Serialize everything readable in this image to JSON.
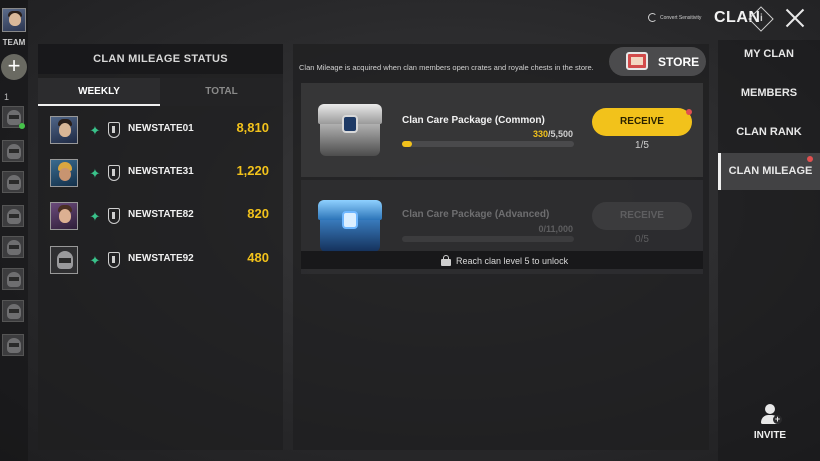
{
  "header": {
    "title": "CLAN",
    "convert_label": "Convert Sensitivity",
    "info_icon": "info-icon",
    "close_icon": "close-icon"
  },
  "team_rail": {
    "label": "TEAM",
    "add_icon": "plus-icon",
    "group_number": "1",
    "slots": 8
  },
  "mileage_panel": {
    "title": "CLAN MILEAGE STATUS",
    "tabs": [
      {
        "label": "WEEKLY",
        "active": true
      },
      {
        "label": "TOTAL",
        "active": false
      }
    ],
    "rows": [
      {
        "name": "NEWSTATE01",
        "score": "8,810"
      },
      {
        "name": "NEWSTATE31",
        "score": "1,220"
      },
      {
        "name": "NEWSTATE82",
        "score": "820"
      },
      {
        "name": "NEWSTATE92",
        "score": "480"
      }
    ]
  },
  "main": {
    "info_text": "Clan Mileage is acquired when clan members open crates and royale chests in the store.",
    "store_label": "STORE",
    "packages": [
      {
        "name": "Clan Care Package (Common)",
        "current": "330",
        "total": "/5,500",
        "progress": 0.06,
        "button": "RECEIVE",
        "count": "1/5",
        "locked": false
      },
      {
        "name": "Clan Care Package (Advanced)",
        "current": "0",
        "total": "/11,000",
        "progress": 0,
        "button": "RECEIVE",
        "count": "0/5",
        "locked": true
      }
    ],
    "lock_text": "Reach clan level 5 to unlock"
  },
  "nav": {
    "items": [
      {
        "label": "MY CLAN",
        "active": false
      },
      {
        "label": "MEMBERS",
        "active": false
      },
      {
        "label": "CLAN RANK",
        "active": false
      },
      {
        "label": "CLAN MILEAGE",
        "active": true
      }
    ]
  },
  "invite": {
    "label": "INVITE",
    "icon": "add-user-icon"
  },
  "colors": {
    "accent": "#f2c21b",
    "notify": "#e05050",
    "online": "#46c24a"
  }
}
